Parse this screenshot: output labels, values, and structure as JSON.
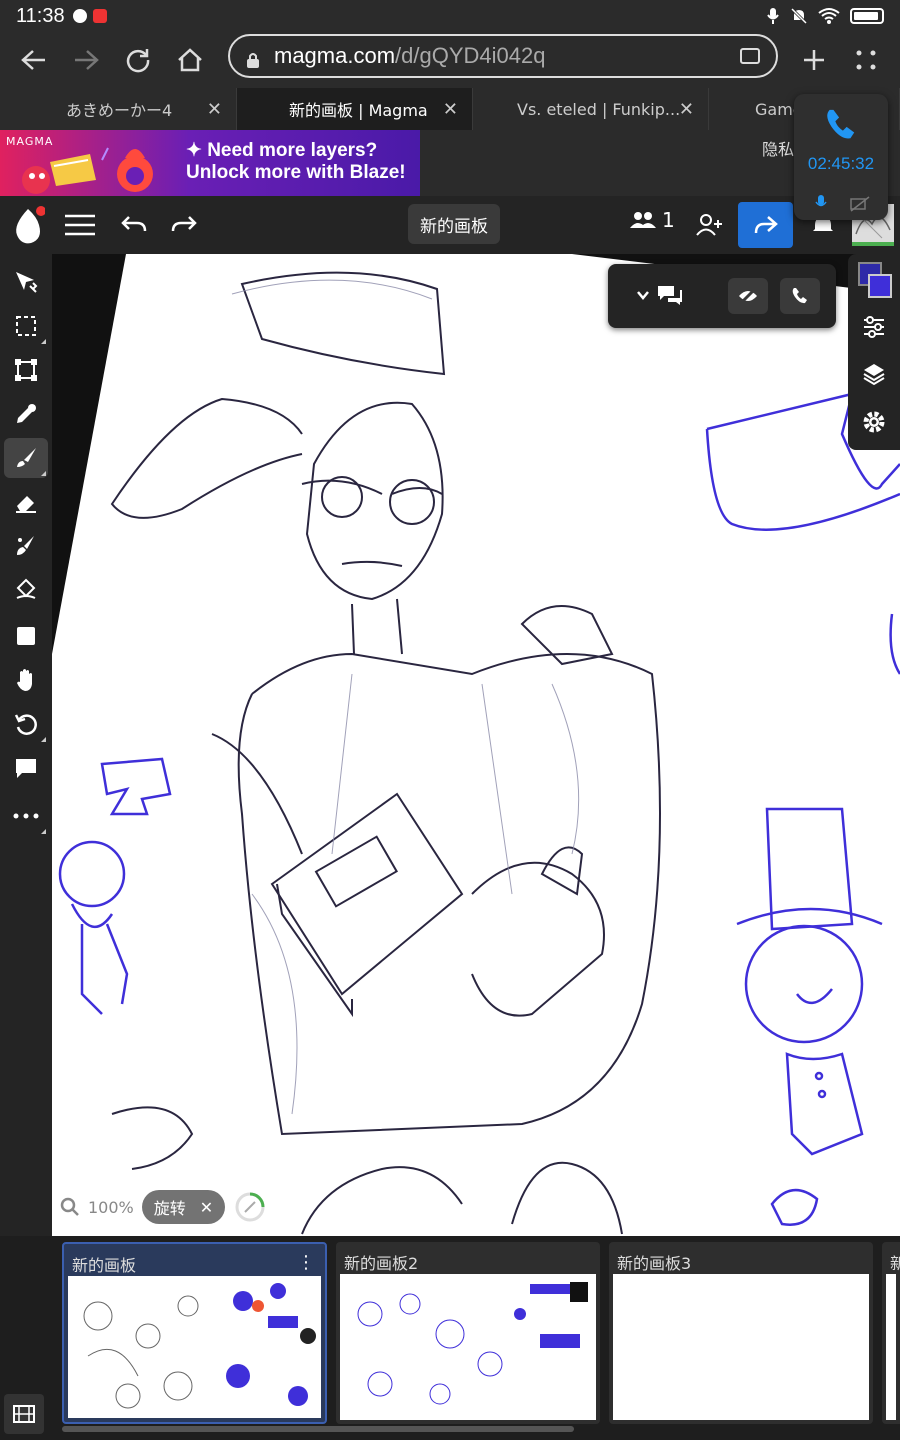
{
  "status_bar": {
    "time": "11:38"
  },
  "browser": {
    "url_host": "magma.com",
    "url_path": "/d/gQYD4i042q",
    "tabs": [
      {
        "title": "あきめーかー4",
        "active": false
      },
      {
        "title": "新的画板 | Magma",
        "active": true
      },
      {
        "title": "Vs. eteled | Funkip...",
        "active": false
      },
      {
        "title": "Game",
        "active": false
      }
    ]
  },
  "ad": {
    "brand": "MAGMA",
    "line1": "✦ Need more layers?",
    "line2": "Unlock more with Blaze!",
    "privacy_label": "隐私"
  },
  "call": {
    "timer": "02:45:32"
  },
  "app_toolbar": {
    "board_name": "新的画板",
    "user_count": "1"
  },
  "zoom": {
    "level": "100%",
    "rotate_label": "旋转"
  },
  "boards": [
    {
      "title": "新的画板",
      "active": true
    },
    {
      "title": "新的画板2",
      "active": false
    },
    {
      "title": "新的画板3",
      "active": false
    },
    {
      "title": "新",
      "active": false
    }
  ],
  "colors": {
    "primary_color": "#2e2aa8",
    "secondary_color": "#3f2fd9",
    "accent_blue": "#1f6fd6",
    "call_blue": "#2196f3"
  }
}
